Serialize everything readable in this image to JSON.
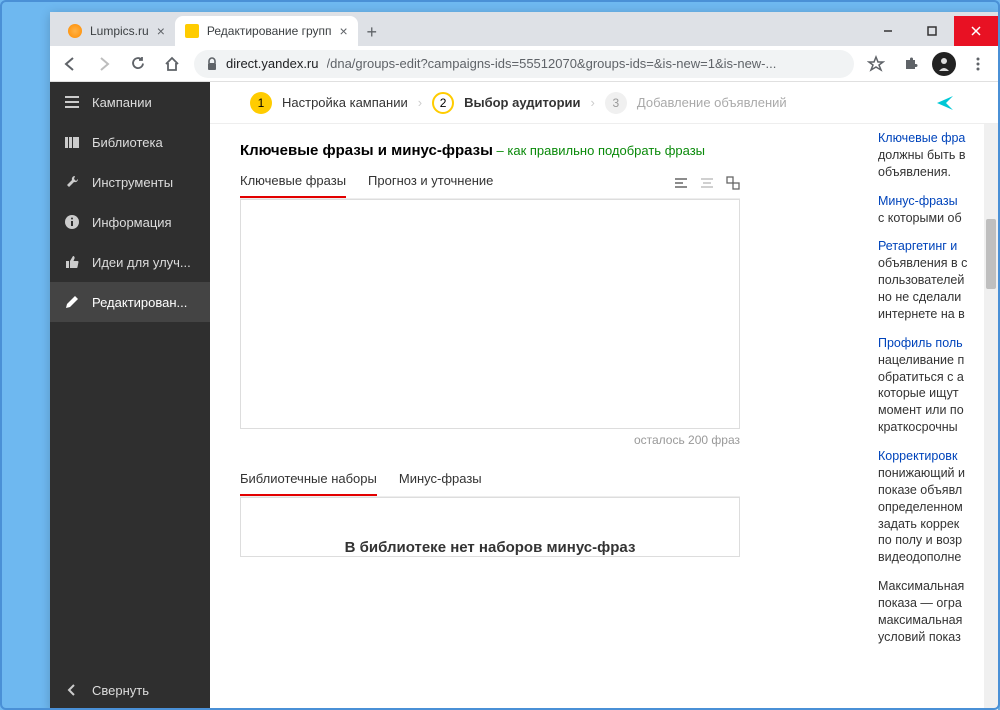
{
  "tabs": [
    {
      "title": "Lumpics.ru",
      "favicon_color": "#ff8c00"
    },
    {
      "title": "Редактирование групп",
      "favicon_color": "#ffcc00"
    }
  ],
  "url": {
    "host": "direct.yandex.ru",
    "path": "/dna/groups-edit?campaigns-ids=55512070&groups-ids=&is-new=1&is-new-..."
  },
  "sidebar": {
    "items": [
      {
        "label": "Кампании"
      },
      {
        "label": "Библиотека"
      },
      {
        "label": "Инструменты"
      },
      {
        "label": "Информация"
      },
      {
        "label": "Идеи для улуч..."
      },
      {
        "label": "Редактирован..."
      }
    ],
    "collapse": "Свернуть"
  },
  "steps": {
    "s1": {
      "num": "1",
      "label": "Настройка кампании"
    },
    "s2": {
      "num": "2",
      "label": "Выбор аудитории"
    },
    "s3": {
      "num": "3",
      "label": "Добавление объявлений"
    }
  },
  "form": {
    "heading": "Ключевые фразы и минус-фразы",
    "heading_link": "– как правильно подобрать фразы",
    "tabs1": {
      "a": "Ключевые фразы",
      "b": "Прогноз и уточнение"
    },
    "remaining": "осталось 200 фраз",
    "tabs2": {
      "a": "Библиотечные наборы",
      "b": "Минус-фразы"
    },
    "lib_empty": "В библиотеке нет наборов минус-фраз"
  },
  "right": {
    "p1a": "Ключевые фра",
    "p1b": "должны быть в",
    "p1c": "объявления.",
    "p2a": "Минус-фразы",
    "p2b": "с которыми об",
    "p3a": "Ретаргетинг и",
    "p3b": "объявления в с",
    "p3c": "пользователей",
    "p3d": "но не сделали",
    "p3e": "интернете на в",
    "p4a": "Профиль поль",
    "p4b": "нацеливание п",
    "p4c": "обратиться с а",
    "p4d": "которые ищут",
    "p4e": "момент или по",
    "p4f": "краткосрочны",
    "p5a": "Корректировк",
    "p5b": "понижающий и",
    "p5c": "показе объявл",
    "p5d": "определенном",
    "p5e": "задать коррек",
    "p5f": "по полу и возр",
    "p5g": "видеодополне",
    "p6a": "Максимальная",
    "p6b": "показа — огра",
    "p6c": "максимальная",
    "p6d": "условий показ"
  }
}
